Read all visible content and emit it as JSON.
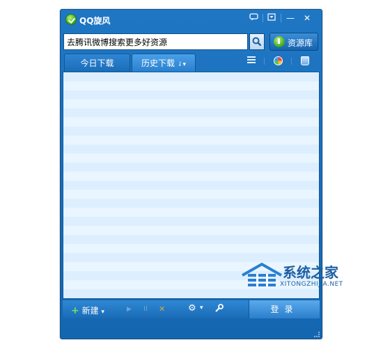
{
  "window": {
    "title": "QQ旋风"
  },
  "titlebar": {
    "chat_icon": "chat-icon",
    "menu_icon": "menu-icon",
    "minimize": "—",
    "close": "✕"
  },
  "search": {
    "value": "去腾讯微博搜索更多好资源",
    "button_icon": "search-icon"
  },
  "resource": {
    "label": "资源库"
  },
  "tabs": [
    {
      "label": "今日下载"
    },
    {
      "label": "历史下载",
      "suffix": "⇃▾"
    }
  ],
  "toolbar_icons": [
    "list-icon",
    "color-icon",
    "trash-icon"
  ],
  "bottom": {
    "new_label": "新建",
    "dropdown": "▾",
    "play": "▶",
    "pause": "II",
    "delete": "✕",
    "settings": "⚙",
    "tools": "🔧",
    "login_label": "登录"
  },
  "watermark": {
    "title": "系统之家",
    "url": "XITONGZHIJIA.NET"
  }
}
